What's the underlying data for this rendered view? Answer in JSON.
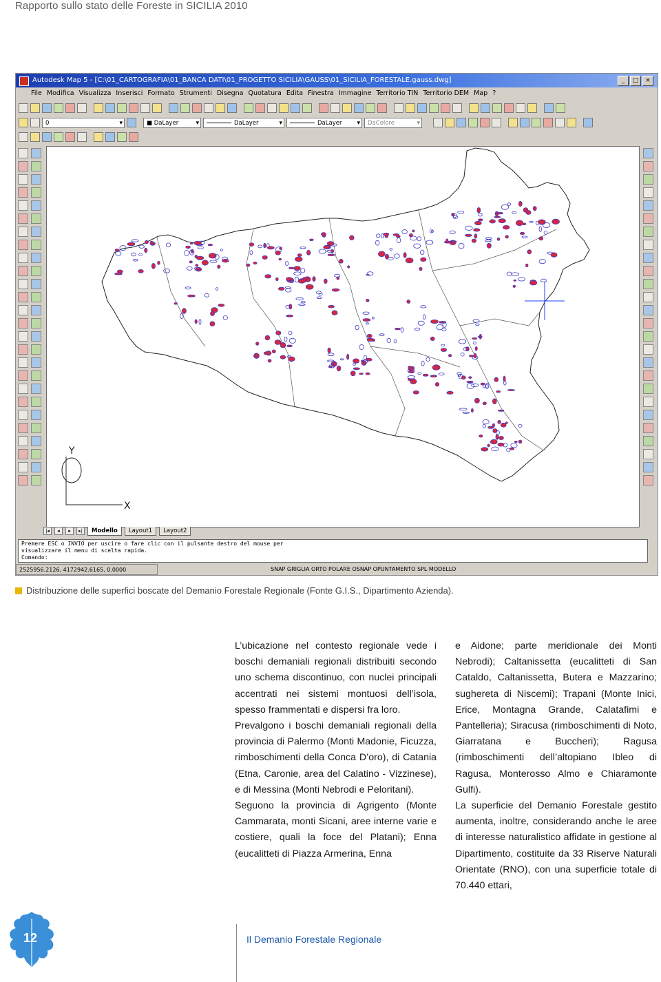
{
  "header": {
    "title": "Rapporto sullo stato delle Foreste in SICILIA 2010"
  },
  "cad": {
    "window_title": "Autodesk Map 5 - [C:\\01_CARTOGRAFIA\\01_BANCA DATI\\01_PROGETTO SICILIA\\GAUSS\\01_SICILIA_FORESTALE.gauss.dwg]",
    "menu": [
      "File",
      "Modifica",
      "Visualizza",
      "Inserisci",
      "Formato",
      "Strumenti",
      "Disegna",
      "Quotatura",
      "Edita",
      "Finestra",
      "Immagine",
      "Territorio TIN",
      "Territorio DEM",
      "Map",
      "?"
    ],
    "toolbar": {
      "layer_value": "0",
      "color_value": "DaLayer",
      "linetype_value": "DaLayer",
      "lineweight_value": "DaLayer",
      "plotstyle_value": "DaColore"
    },
    "tabs": [
      "Modello",
      "Layout1",
      "Layout2"
    ],
    "command_lines": [
      "Premere ESC o INVIO per uscire o fare clic con il pulsante destro del mouse per",
      "visualizzare il menu di scelta rapida.",
      "Comando:"
    ],
    "status_coords": "2525956.2126, 4172942.6165, 0.0000",
    "status_modes": "SNAP  GRIGLIA  ORTO  POLARE  OSNAP  OPUNTAMENTO  SPL  MODELLO",
    "axis_x": "X",
    "axis_y": "Y"
  },
  "caption": {
    "text": "Distribuzione delle superfici boscate del Demanio Forestale Regionale (Fonte G.I.S., Dipartimento Azienda)."
  },
  "body": {
    "col1": [
      "L’ubicazione nel contesto regionale vede i boschi demaniali regionali distribuiti secondo uno schema discontinuo, con nuclei principali accentrati nei sistemi montuosi dell’isola, spesso frammentati e dispersi fra loro.",
      "Prevalgono i boschi demaniali regionali della provincia di Palermo (Monti Madonie, Ficuzza, rimboschimenti della Conca D’oro), di Catania (Etna, Caronie, area del Calatino - Vizzinese), e di Messina (Monti Nebrodi e Peloritani).",
      "Seguono la provincia di Agrigento (Monte Cammarata, monti Sicani, aree interne varie e costiere, quali la foce del Platani); Enna (eucalitteti di Piazza Armerina, Enna"
    ],
    "col2": [
      "e Aidone; parte meridionale dei Monti Nebrodi); Caltanissetta (eucalitteti di San Cataldo, Caltanissetta, Butera e Mazzarino; sughereta di Niscemi); Trapani (Monte Inici, Erice, Montagna Grande, Calatafimi e Pantelleria); Siracusa (rimboschimenti di Noto, Giarratana e Buccheri); Ragusa (rimboschimenti dell’altopiano Ibleo di Ragusa, Monterosso Almo e Chiaramonte Gulfi).",
      "La superficie del Demanio Forestale gestito aumenta, inoltre, considerando anche le aree di interesse naturalistico affidate in gestione al Dipartimento, costituite da 33 Riserve Naturali Orientate (RNO), con una superficie totale di 70.440 ettari,"
    ]
  },
  "footer": {
    "page_number": "12",
    "section": "Il Demanio Forestale Regionale"
  },
  "colors": {
    "accent": "#1e5aa8",
    "caption_square": "#e6b800",
    "forest_red": "#d8263c",
    "forest_blue": "#3c3cc8"
  },
  "icons": [
    "oak-leaf-icon"
  ]
}
